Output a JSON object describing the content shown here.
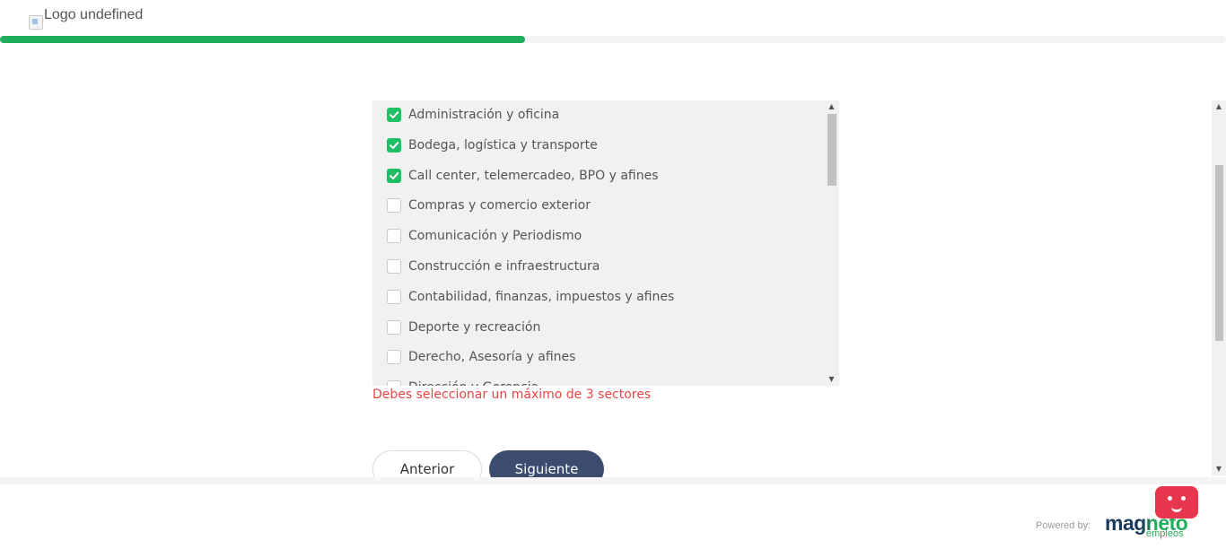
{
  "header": {
    "logo_alt": "Logo undefined",
    "progress_fraction": 0.428
  },
  "sectors": {
    "items": [
      {
        "label": "Administración y oficina",
        "checked": true
      },
      {
        "label": "Bodega, logística y transporte",
        "checked": true
      },
      {
        "label": "Call center, telemercadeo, BPO y afines",
        "checked": true
      },
      {
        "label": "Compras y comercio exterior",
        "checked": false
      },
      {
        "label": "Comunicación y Periodismo",
        "checked": false
      },
      {
        "label": "Construcción e infraestructura",
        "checked": false
      },
      {
        "label": "Contabilidad, finanzas, impuestos y afines",
        "checked": false
      },
      {
        "label": "Deporte y recreación",
        "checked": false
      },
      {
        "label": "Derecho, Asesoría y afines",
        "checked": false
      },
      {
        "label": "Dirección y Gerencia",
        "checked": false
      }
    ],
    "error_message": "Debes seleccionar un máximo de 3 sectores"
  },
  "actions": {
    "prev_label": "Anterior",
    "next_label": "Siguiente"
  },
  "footer": {
    "powered_by": "Powered by:",
    "brand_name": "magneto",
    "brand_sub": "empleos"
  },
  "colors": {
    "accent_green": "#1fae5b",
    "checkbox_green": "#1fbf66",
    "primary_button": "#3b4c6e",
    "error_red": "#e84545",
    "chat_red": "#e8364f"
  },
  "icons": {
    "check": "check-icon",
    "scroll_up": "scroll-up-icon",
    "scroll_down": "scroll-down-icon",
    "chat_bot": "chat-bot-icon"
  }
}
